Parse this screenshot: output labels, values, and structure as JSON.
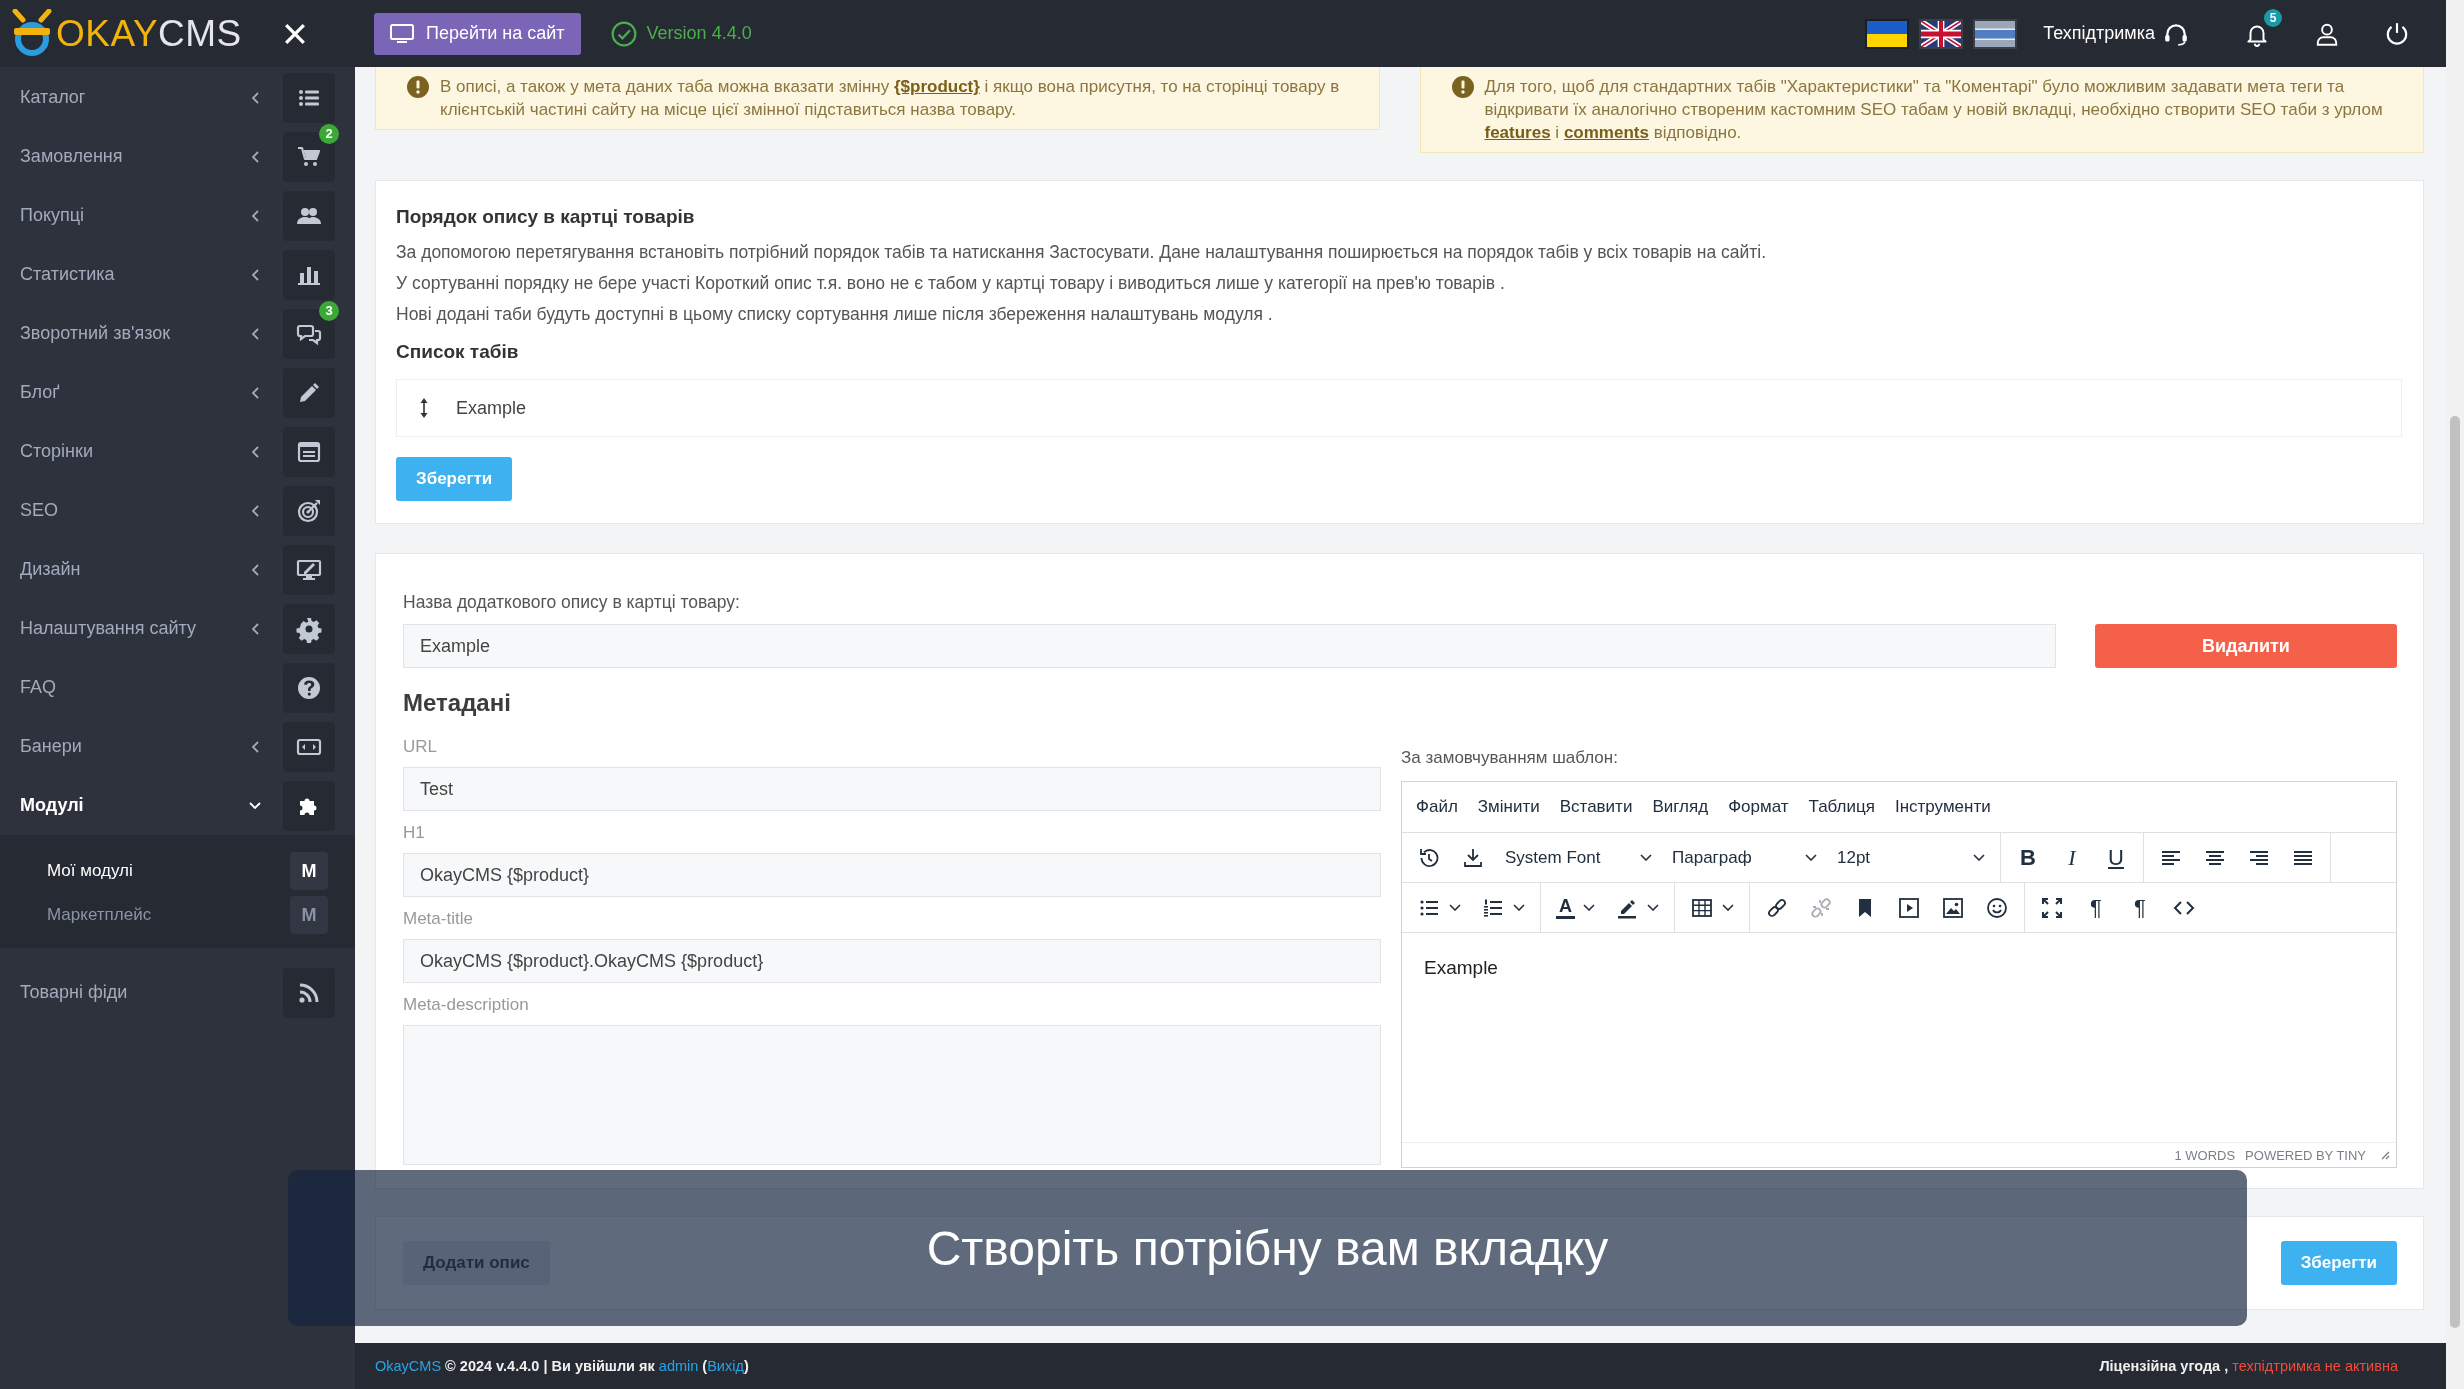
{
  "header": {
    "logo": {
      "accent": "OKAY",
      "rest": "CMS"
    },
    "site_button": "Перейти на сайт",
    "version": "Version 4.4.0",
    "support": "Техпідтримка",
    "notifications": "5"
  },
  "sidebar": {
    "items": [
      {
        "label": "Каталог",
        "kind": "group",
        "expanded": false,
        "selected": false
      },
      {
        "label": "Замовлення",
        "kind": "group",
        "expanded": false,
        "selected": false,
        "badge": "2"
      },
      {
        "label": "Покупці",
        "kind": "group",
        "expanded": false,
        "selected": false
      },
      {
        "label": "Статистика",
        "kind": "group",
        "expanded": false,
        "selected": false
      },
      {
        "label": "Зворотний зв'язок",
        "kind": "group",
        "expanded": false,
        "selected": false,
        "badge": "3"
      },
      {
        "label": "Блоґ",
        "kind": "group",
        "expanded": false,
        "selected": false
      },
      {
        "label": "Сторінки",
        "kind": "group",
        "expanded": false,
        "selected": false
      },
      {
        "label": "SEO",
        "kind": "group",
        "expanded": false,
        "selected": false
      },
      {
        "label": "Дизайн",
        "kind": "group",
        "expanded": false,
        "selected": false
      },
      {
        "label": "Налаштування сайту",
        "kind": "group",
        "expanded": false,
        "selected": false
      },
      {
        "label": "FAQ",
        "kind": "link",
        "selected": false
      },
      {
        "label": "Банери",
        "kind": "group",
        "expanded": false,
        "selected": false
      },
      {
        "label": "Модулі",
        "kind": "group",
        "expanded": true,
        "selected": true,
        "children": [
          {
            "label": "Мої модулі",
            "icon_letter": "M",
            "selected": true
          },
          {
            "label": "Маркетплейс",
            "icon_letter": "M",
            "selected": false
          }
        ]
      },
      {
        "label": "Товарні фіди",
        "kind": "link",
        "selected": false
      }
    ]
  },
  "alerts": [
    {
      "parts": [
        {
          "kind": "text",
          "text": "В описі, а також у мета даних таба можна вказати змінну "
        },
        {
          "kind": "link",
          "text": "{$product}"
        },
        {
          "kind": "text",
          "text": " і якщо вона присутня, то на сторінці товару в клієнтській частині сайту на місце цієї змінної підставиться назва товару."
        }
      ]
    },
    {
      "parts": [
        {
          "kind": "text",
          "text": "Для того, щоб для стандартних табів \"Характеристики\" та \"Коментарі\" було можливим задавати мета теги та відкривати їх аналогічно створеним кастомним SEO табам у новій вкладці, необхідно створити SEO таби з урлом "
        },
        {
          "kind": "link",
          "text": "features"
        },
        {
          "kind": "text",
          "text": " і "
        },
        {
          "kind": "link",
          "text": "comments"
        },
        {
          "kind": "text",
          "text": " відповідно."
        }
      ]
    }
  ],
  "tabs_order": {
    "title": "Порядок опису в картці товарів",
    "paragraphs": [
      "За допомогою перетягування встановіть потрібний порядок табів та натискання Застосувати. Дане налаштування поширюється на порядок табів у всіх товарів на сайті.",
      "У сортуванні порядку не бере участі Короткий опис т.я. воно не є табом у картці товару і виводиться лише у категорії на прев'ю товарів .",
      "Нові додані таби будуть доступні в цьому списку сортування лише після збереження налаштувань модуля ."
    ],
    "list_title": "Список табів",
    "items": [
      {
        "label": "Example"
      }
    ],
    "save_button": "Зберегти"
  },
  "description": {
    "name_label": "Назва додаткового опису в картці товару:",
    "name_value": "Example",
    "delete_button": "Видалити",
    "meta_title": "Метадані",
    "fields": [
      {
        "kind": "input",
        "label": "URL",
        "value": "Test"
      },
      {
        "kind": "input",
        "label": "H1",
        "value": "OkayCMS {$product}"
      },
      {
        "kind": "input",
        "label": "Meta-title",
        "value": "OkayCMS {$product}.OkayCMS {$product}"
      },
      {
        "kind": "textarea",
        "label": "Meta-description"
      }
    ],
    "editor": {
      "label": "За замовчуванням шаблон:",
      "menu": [
        "Файл",
        "Змінити",
        "Вставити",
        "Вигляд",
        "Формат",
        "Таблиця",
        "Інструменти"
      ],
      "font": "System Font",
      "block_format": "Параграф",
      "font_size": "12pt",
      "bold_button": "B",
      "italic_button": "I",
      "underline_button": "U",
      "text_color_button": "A",
      "ltr_button": "¶",
      "rtl_button": "¶",
      "unlink_disabled": true,
      "content": "Example",
      "word_count": "1 WORDS",
      "branding": "POWERED BY TINY"
    }
  },
  "actions": {
    "add_button": "Додати опис",
    "save_button": "Зберегти"
  },
  "caption": "Створіть потрібну вам вкладку",
  "footer": {
    "left": [
      {
        "kind": "link",
        "text": "OkayCMS"
      },
      {
        "kind": "text",
        "text": " © 2024 v.4.4.0 | Ви увійшли як "
      },
      {
        "kind": "link",
        "text": "admin"
      },
      {
        "kind": "text",
        "text": " ("
      },
      {
        "kind": "link",
        "text": "Вихід"
      },
      {
        "kind": "text",
        "text": ")"
      }
    ],
    "right": [
      {
        "kind": "link",
        "text": "Ліцензійна угода"
      },
      {
        "kind": "text",
        "text": " , "
      },
      {
        "kind": "warning",
        "text": "техпідтримка не активна"
      }
    ]
  }
}
